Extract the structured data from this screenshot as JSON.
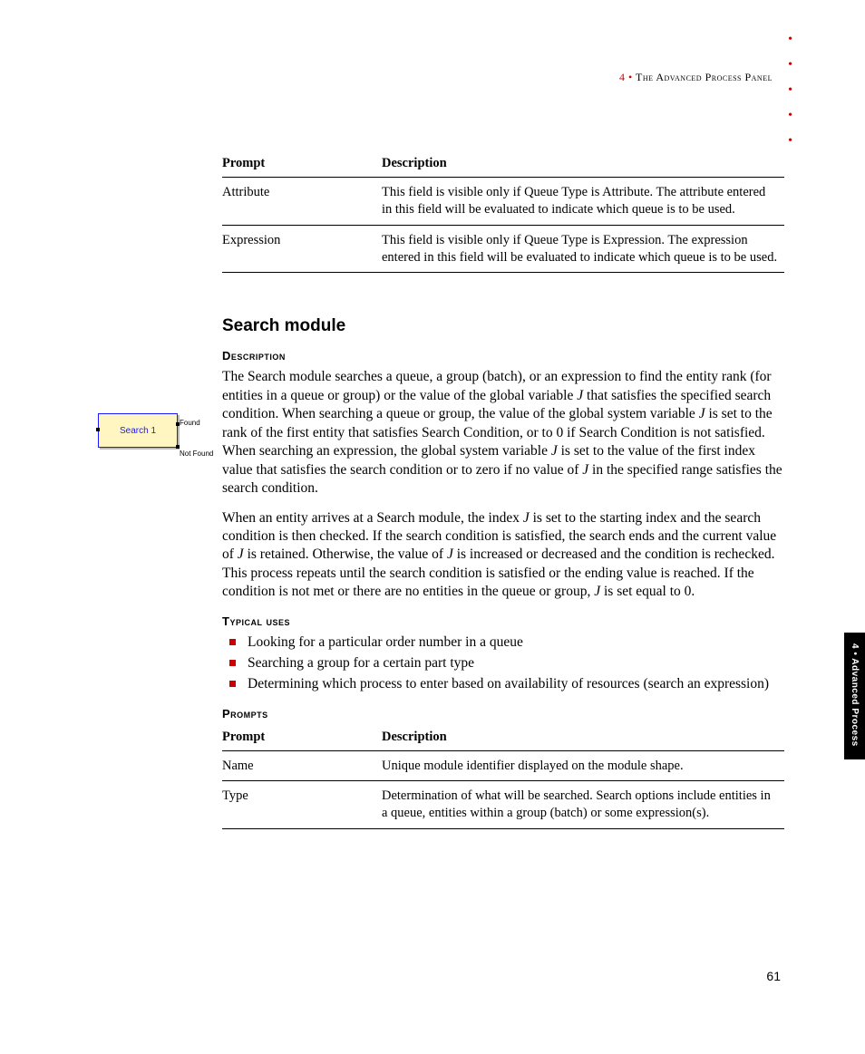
{
  "header": {
    "chapter_number": "4",
    "chapter_title": "The Advanced Process Panel"
  },
  "side_tab": "4 • Advanced Process",
  "page_number": "61",
  "table1": {
    "headers": {
      "prompt": "Prompt",
      "description": "Description"
    },
    "rows": [
      {
        "prompt": "Attribute",
        "description": "This field is visible only if Queue Type is Attribute. The attribute entered in this field will be evaluated to indicate which queue is to be used."
      },
      {
        "prompt": "Expression",
        "description": "This field is visible only if Queue Type is Expression. The expression entered in this field will be evaluated to indicate which queue is to be used."
      }
    ]
  },
  "section": {
    "title": "Search module",
    "h_desc": "Description",
    "para1_a": "The Search module searches a queue, a group (batch), or an expression to find the entity rank (for entities in a queue or group) or the value of the global variable ",
    "J": "J",
    "para1_b": " that satisfies the specified search condition. When searching a queue or group, the value of the global system variable ",
    "para1_c": " is set to the rank of the first entity that satisfies Search Condition, or to 0 if Search Condition is not satisfied. When searching an expression, the global system variable ",
    "para1_d": " is set to the value of the first index value that satisfies the search condition or to zero if no value of ",
    "para1_e": " in the specified range satisfies the search condition.",
    "para2_a": "When an entity arrives at a Search module, the index ",
    "para2_b": " is set to the starting index and the search condition is then checked. If the search condition is satisfied, the search ends and the current value of ",
    "para2_c": " is retained. Otherwise, the value of ",
    "para2_d": " is increased or decreased and the condition is rechecked. This process repeats until the search condition is satisfied or the ending value is reached. If the condition is not met or there are no entities in the queue or group, ",
    "para2_e": " is set equal to 0.",
    "h_uses": "Typical uses",
    "uses": [
      "Looking for a particular order number in a queue",
      "Searching a group for a certain part type",
      "Determining which process to enter based on availability of resources (search an expression)"
    ],
    "h_prompts": "Prompts"
  },
  "table2": {
    "headers": {
      "prompt": "Prompt",
      "description": "Description"
    },
    "rows": [
      {
        "prompt": "Name",
        "description": "Unique module identifier displayed on the module shape."
      },
      {
        "prompt": "Type",
        "description": "Determination of what will be searched. Search options include entities in a queue, entities within a group (batch) or some expression(s)."
      }
    ]
  },
  "figure": {
    "module_label": "Search 1",
    "out1": "Found",
    "out2": "Not Found"
  }
}
